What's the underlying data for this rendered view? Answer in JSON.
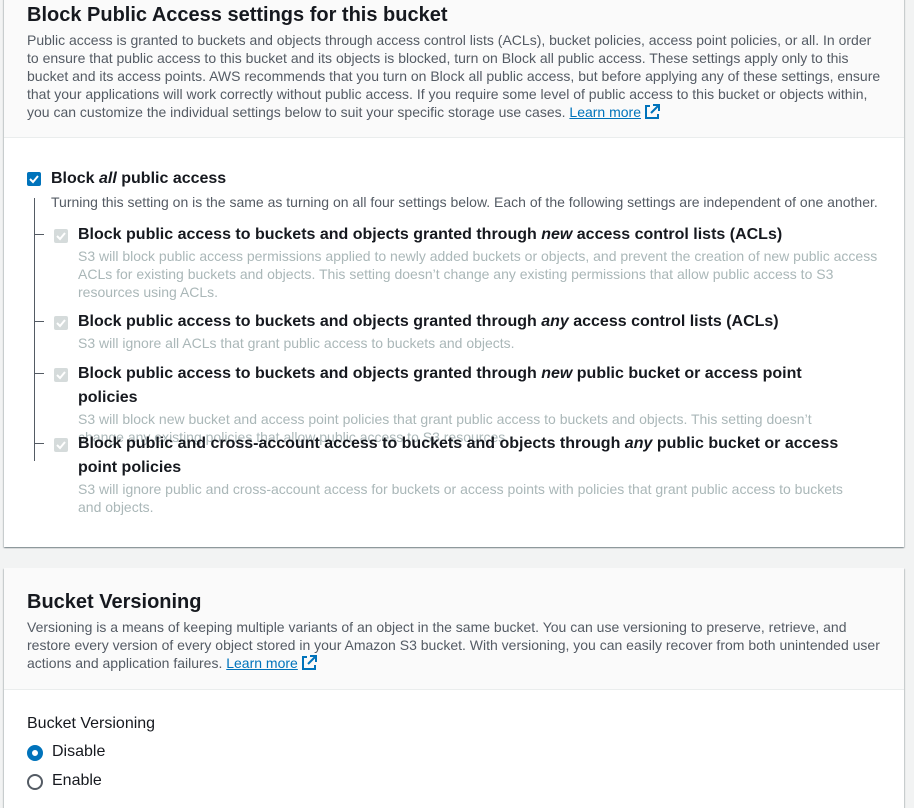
{
  "bpa": {
    "title": "Block Public Access settings for this bucket",
    "description": "Public access is granted to buckets and objects through access control lists (ACLs), bucket policies, access point policies, or all. In order to ensure that public access to this bucket and its objects is blocked, turn on Block all public access. These settings apply only to this bucket and its access points. AWS recommends that you turn on Block all public access, but before applying any of these settings, ensure that your applications will work correctly without public access. If you require some level of public access to this bucket or objects within, you can customize the individual settings below to suit your specific storage use cases.",
    "learn_more": "Learn more",
    "block_all": {
      "label_pre": "Block ",
      "label_em": "all",
      "label_post": " public access",
      "description": "Turning this setting on is the same as turning on all four settings below. Each of the following settings are independent of one another.",
      "checked": true
    },
    "options": [
      {
        "label_pre": "Block public access to buckets and objects granted through ",
        "label_em": "new",
        "label_post": " access control lists (ACLs)",
        "description": "S3 will block public access permissions applied to newly added buckets or objects, and prevent the creation of new public access ACLs for existing buckets and objects. This setting doesn’t change any existing permissions that allow public access to S3 resources using ACLs.",
        "checked": true
      },
      {
        "label_pre": "Block public access to buckets and objects granted through ",
        "label_em": "any",
        "label_post": " access control lists (ACLs)",
        "description": "S3 will ignore all ACLs that grant public access to buckets and objects.",
        "checked": true
      },
      {
        "label_pre": "Block public access to buckets and objects granted through ",
        "label_em": "new",
        "label_post": " public bucket or access point policies",
        "description": "S3 will block new bucket and access point policies that grant public access to buckets and objects. This setting doesn’t change any existing policies that allow public access to S3 resources.",
        "checked": true
      },
      {
        "label_pre": "Block public and cross-account access to buckets and objects through ",
        "label_em": "any",
        "label_post": " public bucket or access point policies",
        "description": "S3 will ignore public and cross-account access for buckets or access points with policies that grant public access to buckets and objects.",
        "checked": true
      }
    ]
  },
  "versioning": {
    "title": "Bucket Versioning",
    "description": "Versioning is a means of keeping multiple variants of an object in the same bucket. You can use versioning to preserve, retrieve, and restore every version of every object stored in your Amazon S3 bucket. With versioning, you can easily recover from both unintended user actions and application failures.",
    "learn_more": "Learn more",
    "field_label": "Bucket Versioning",
    "options": [
      {
        "label": "Disable",
        "selected": true
      },
      {
        "label": "Enable",
        "selected": false
      }
    ]
  },
  "colors": {
    "accent": "#0073bb",
    "disabled_check": "#d5dbdb",
    "disabled_text": "#aab7b8",
    "secondary_text": "#545b64"
  }
}
